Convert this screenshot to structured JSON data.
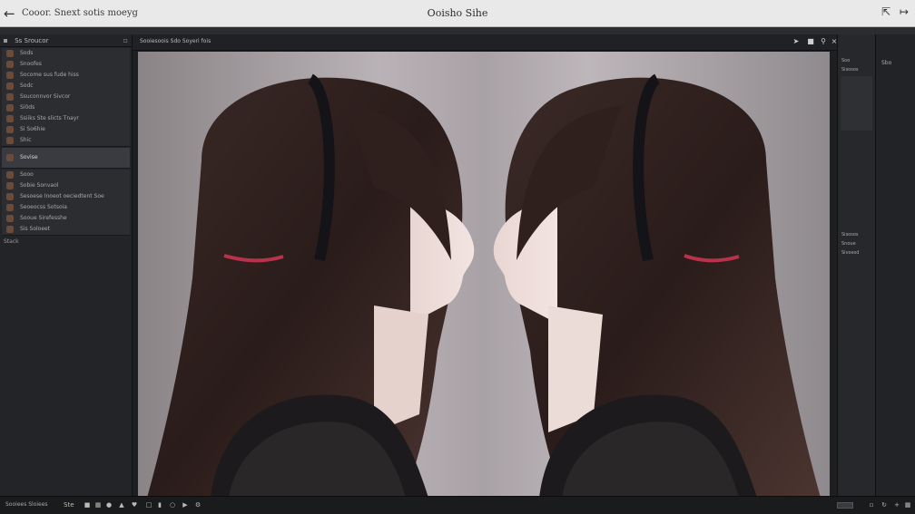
{
  "titlebar": {
    "crumb": "Cooor. Snext sotis moeyg",
    "title": "Ooisho Sihe"
  },
  "left_panel": {
    "header": "Ss Sroucor",
    "layers": [
      {
        "label": "Sods",
        "selected": false
      },
      {
        "label": "Snoofes",
        "selected": false
      },
      {
        "label": "Socome sus fude hiss",
        "selected": false
      },
      {
        "label": "Sodc",
        "selected": false
      },
      {
        "label": "Ssuconnvor Sivcor",
        "selected": false
      },
      {
        "label": "Si0ds",
        "selected": false
      },
      {
        "label": "Ssiiks Ste slicts Tnayr",
        "selected": false
      },
      {
        "label": "Si So6hie",
        "selected": false
      },
      {
        "label": "Shic",
        "selected": false
      },
      {
        "label": "Sovise",
        "selected": true
      },
      {
        "label": "Sooo",
        "selected": false
      },
      {
        "label": "Sobie Sonvaol",
        "selected": false
      },
      {
        "label": "Sesoese Inoeot oeciedtent Soe",
        "selected": false
      },
      {
        "label": "Seoeocss Sotsoia",
        "selected": false
      },
      {
        "label": "Sooue Sirefesshe",
        "selected": false
      },
      {
        "label": "Sis Soloeet",
        "selected": false
      }
    ],
    "footer": "Stack"
  },
  "canvas": {
    "doc_title": "Sooiesoois Sdo Soyeri fois",
    "image_description_icon": "portrait-image"
  },
  "right_panel": {
    "items": [
      "Soo",
      "Sisosos",
      "Sisosos",
      "Snoue",
      "Sivoesd"
    ]
  },
  "right_panel2": {
    "items": [
      "Sbo"
    ]
  },
  "bottombar": {
    "zoom": "Sooiees Sloiees",
    "page": "Ste"
  }
}
